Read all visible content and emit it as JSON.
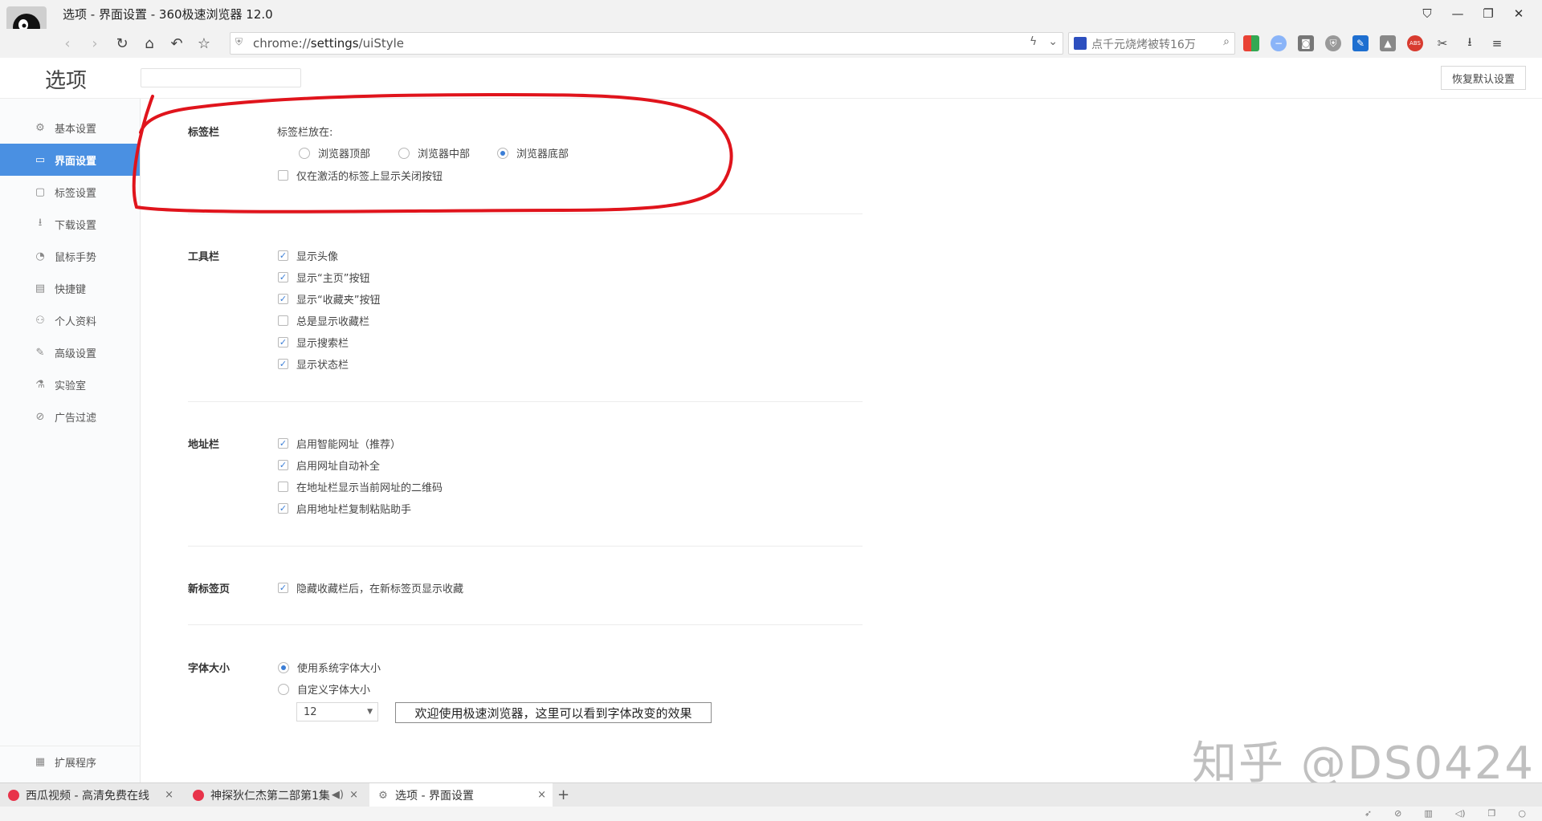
{
  "window": {
    "title": "选项 - 界面设置 - 360极速浏览器 12.0",
    "buttons": [
      "⛉",
      "—",
      "❐",
      "✕"
    ]
  },
  "toolbar": {
    "url_prefix": "chrome://",
    "url_host": "settings",
    "url_path": "/uiStyle",
    "search_text": "点千元烧烤被转16万"
  },
  "header": {
    "title": "选项",
    "reset_label": "恢复默认设置"
  },
  "sidebar": {
    "items": [
      {
        "label": "基本设置",
        "icon": "gear-icon",
        "glyph": "⚙"
      },
      {
        "label": "界面设置",
        "icon": "window-icon",
        "glyph": "▭"
      },
      {
        "label": "标签设置",
        "icon": "tab-icon",
        "glyph": "▢"
      },
      {
        "label": "下载设置",
        "icon": "download-icon",
        "glyph": "⭳"
      },
      {
        "label": "鼠标手势",
        "icon": "mouse-icon",
        "glyph": "◔"
      },
      {
        "label": "快捷键",
        "icon": "keyboard-icon",
        "glyph": "▤"
      },
      {
        "label": "个人资料",
        "icon": "user-icon",
        "glyph": "⚇"
      },
      {
        "label": "高级设置",
        "icon": "advanced-icon",
        "glyph": "✎"
      },
      {
        "label": "实验室",
        "icon": "flask-icon",
        "glyph": "⚗"
      },
      {
        "label": "广告过滤",
        "icon": "block-icon",
        "glyph": "⊘"
      }
    ],
    "extensions": {
      "label": "扩展程序",
      "icon": "extension-icon",
      "glyph": "▦"
    }
  },
  "sections": {
    "tabbar": {
      "title": "标签栏",
      "position_label": "标签栏放在:",
      "options": [
        "浏览器顶部",
        "浏览器中部",
        "浏览器底部"
      ],
      "selected": "浏览器底部",
      "close_on_active": "仅在激活的标签上显示关闭按钮"
    },
    "toolbar": {
      "title": "工具栏",
      "items": [
        {
          "label": "显示头像",
          "checked": true
        },
        {
          "label": "显示“主页”按钮",
          "checked": true
        },
        {
          "label": "显示“收藏夹”按钮",
          "checked": true
        },
        {
          "label": "总是显示收藏栏",
          "checked": false
        },
        {
          "label": "显示搜索栏",
          "checked": true
        },
        {
          "label": "显示状态栏",
          "checked": true
        }
      ]
    },
    "addressbar": {
      "title": "地址栏",
      "items": [
        {
          "label": "启用智能网址（推荐）",
          "checked": true
        },
        {
          "label": "启用网址自动补全",
          "checked": true
        },
        {
          "label": "在地址栏显示当前网址的二维码",
          "checked": false
        },
        {
          "label": "启用地址栏复制粘贴助手",
          "checked": true
        }
      ]
    },
    "newtab": {
      "title": "新标签页",
      "items": [
        {
          "label": "隐藏收藏栏后，在新标签页显示收藏",
          "checked": true
        }
      ]
    },
    "fontsize": {
      "title": "字体大小",
      "options": [
        "使用系统字体大小",
        "自定义字体大小"
      ],
      "selected": "使用系统字体大小",
      "size_value": "12",
      "preview_text": "欢迎使用极速浏览器，这里可以看到字体改变的效果"
    }
  },
  "tabs": [
    {
      "title": "西瓜视频 - 高清免费在线",
      "color": "#e8334a",
      "active": false
    },
    {
      "title": "神探狄仁杰第二部第1集",
      "color": "#e8334a",
      "active": false
    },
    {
      "title": "选项 - 界面设置",
      "color": "#777777",
      "active": true
    }
  ],
  "watermark": "知乎 @DS0424",
  "colors": {
    "accent": "#4a90e2",
    "annotation": "#e0141c"
  }
}
